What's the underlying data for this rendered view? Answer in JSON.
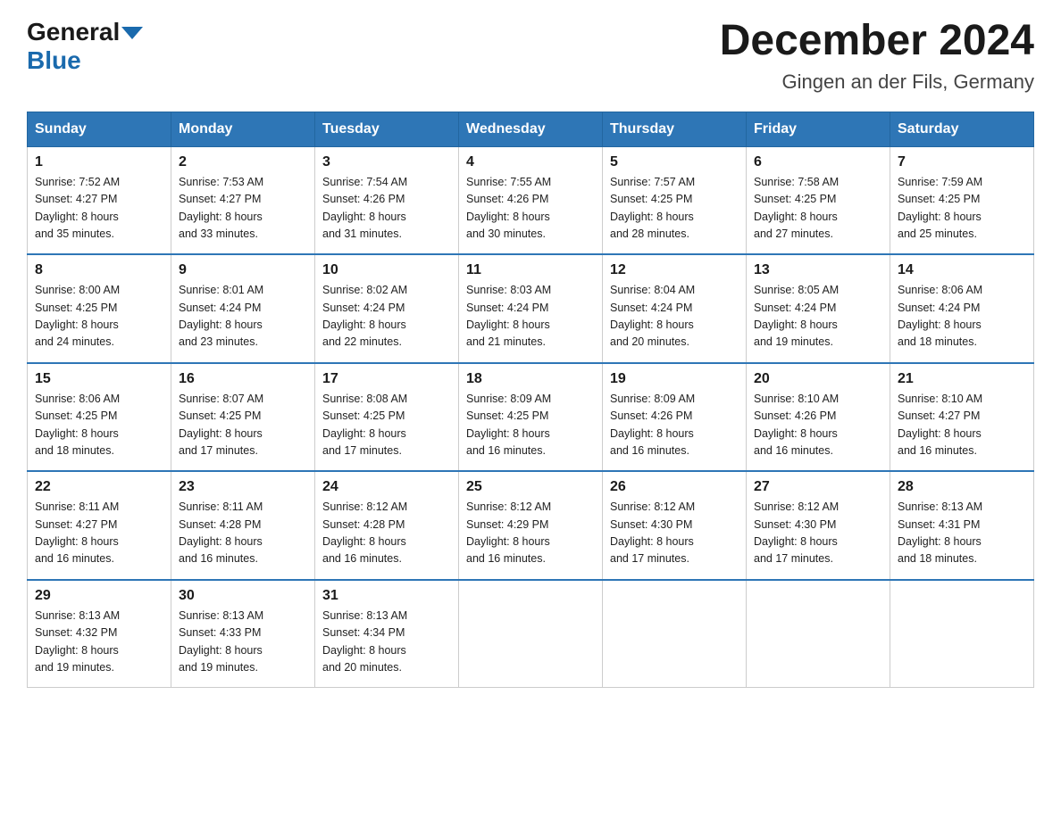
{
  "header": {
    "logo": {
      "general": "General",
      "blue": "Blue"
    },
    "title": "December 2024",
    "subtitle": "Gingen an der Fils, Germany"
  },
  "weekdays": [
    "Sunday",
    "Monday",
    "Tuesday",
    "Wednesday",
    "Thursday",
    "Friday",
    "Saturday"
  ],
  "weeks": [
    [
      {
        "day": "1",
        "sunrise": "7:52 AM",
        "sunset": "4:27 PM",
        "daylight": "8 hours and 35 minutes."
      },
      {
        "day": "2",
        "sunrise": "7:53 AM",
        "sunset": "4:27 PM",
        "daylight": "8 hours and 33 minutes."
      },
      {
        "day": "3",
        "sunrise": "7:54 AM",
        "sunset": "4:26 PM",
        "daylight": "8 hours and 31 minutes."
      },
      {
        "day": "4",
        "sunrise": "7:55 AM",
        "sunset": "4:26 PM",
        "daylight": "8 hours and 30 minutes."
      },
      {
        "day": "5",
        "sunrise": "7:57 AM",
        "sunset": "4:25 PM",
        "daylight": "8 hours and 28 minutes."
      },
      {
        "day": "6",
        "sunrise": "7:58 AM",
        "sunset": "4:25 PM",
        "daylight": "8 hours and 27 minutes."
      },
      {
        "day": "7",
        "sunrise": "7:59 AM",
        "sunset": "4:25 PM",
        "daylight": "8 hours and 25 minutes."
      }
    ],
    [
      {
        "day": "8",
        "sunrise": "8:00 AM",
        "sunset": "4:25 PM",
        "daylight": "8 hours and 24 minutes."
      },
      {
        "day": "9",
        "sunrise": "8:01 AM",
        "sunset": "4:24 PM",
        "daylight": "8 hours and 23 minutes."
      },
      {
        "day": "10",
        "sunrise": "8:02 AM",
        "sunset": "4:24 PM",
        "daylight": "8 hours and 22 minutes."
      },
      {
        "day": "11",
        "sunrise": "8:03 AM",
        "sunset": "4:24 PM",
        "daylight": "8 hours and 21 minutes."
      },
      {
        "day": "12",
        "sunrise": "8:04 AM",
        "sunset": "4:24 PM",
        "daylight": "8 hours and 20 minutes."
      },
      {
        "day": "13",
        "sunrise": "8:05 AM",
        "sunset": "4:24 PM",
        "daylight": "8 hours and 19 minutes."
      },
      {
        "day": "14",
        "sunrise": "8:06 AM",
        "sunset": "4:24 PM",
        "daylight": "8 hours and 18 minutes."
      }
    ],
    [
      {
        "day": "15",
        "sunrise": "8:06 AM",
        "sunset": "4:25 PM",
        "daylight": "8 hours and 18 minutes."
      },
      {
        "day": "16",
        "sunrise": "8:07 AM",
        "sunset": "4:25 PM",
        "daylight": "8 hours and 17 minutes."
      },
      {
        "day": "17",
        "sunrise": "8:08 AM",
        "sunset": "4:25 PM",
        "daylight": "8 hours and 17 minutes."
      },
      {
        "day": "18",
        "sunrise": "8:09 AM",
        "sunset": "4:25 PM",
        "daylight": "8 hours and 16 minutes."
      },
      {
        "day": "19",
        "sunrise": "8:09 AM",
        "sunset": "4:26 PM",
        "daylight": "8 hours and 16 minutes."
      },
      {
        "day": "20",
        "sunrise": "8:10 AM",
        "sunset": "4:26 PM",
        "daylight": "8 hours and 16 minutes."
      },
      {
        "day": "21",
        "sunrise": "8:10 AM",
        "sunset": "4:27 PM",
        "daylight": "8 hours and 16 minutes."
      }
    ],
    [
      {
        "day": "22",
        "sunrise": "8:11 AM",
        "sunset": "4:27 PM",
        "daylight": "8 hours and 16 minutes."
      },
      {
        "day": "23",
        "sunrise": "8:11 AM",
        "sunset": "4:28 PM",
        "daylight": "8 hours and 16 minutes."
      },
      {
        "day": "24",
        "sunrise": "8:12 AM",
        "sunset": "4:28 PM",
        "daylight": "8 hours and 16 minutes."
      },
      {
        "day": "25",
        "sunrise": "8:12 AM",
        "sunset": "4:29 PM",
        "daylight": "8 hours and 16 minutes."
      },
      {
        "day": "26",
        "sunrise": "8:12 AM",
        "sunset": "4:30 PM",
        "daylight": "8 hours and 17 minutes."
      },
      {
        "day": "27",
        "sunrise": "8:12 AM",
        "sunset": "4:30 PM",
        "daylight": "8 hours and 17 minutes."
      },
      {
        "day": "28",
        "sunrise": "8:13 AM",
        "sunset": "4:31 PM",
        "daylight": "8 hours and 18 minutes."
      }
    ],
    [
      {
        "day": "29",
        "sunrise": "8:13 AM",
        "sunset": "4:32 PM",
        "daylight": "8 hours and 19 minutes."
      },
      {
        "day": "30",
        "sunrise": "8:13 AM",
        "sunset": "4:33 PM",
        "daylight": "8 hours and 19 minutes."
      },
      {
        "day": "31",
        "sunrise": "8:13 AM",
        "sunset": "4:34 PM",
        "daylight": "8 hours and 20 minutes."
      },
      null,
      null,
      null,
      null
    ]
  ],
  "labels": {
    "sunrise": "Sunrise:",
    "sunset": "Sunset:",
    "daylight": "Daylight:"
  }
}
